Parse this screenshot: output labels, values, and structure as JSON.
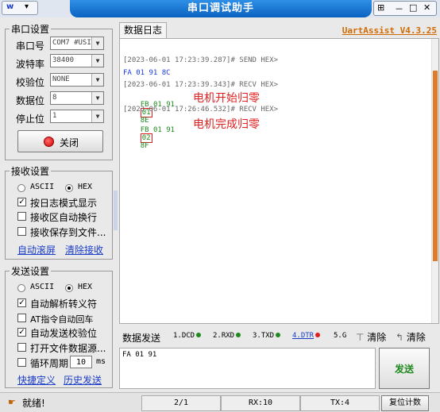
{
  "window": {
    "title": "串口调试助手",
    "menu_icon": "w",
    "menu_arrow": "▾",
    "pin": "⊞",
    "minimize": "－",
    "maximize": "□",
    "close": "✕"
  },
  "serial": {
    "group_title": "串口设置",
    "port_label": "串口号",
    "port_value": "COM7 #USI",
    "baud_label": "波特率",
    "baud_value": "38400",
    "parity_label": "校验位",
    "parity_value": "NONE",
    "databits_label": "数据位",
    "databits_value": "8",
    "stopbits_label": "停止位",
    "stopbits_value": "1",
    "close_label": "关闭"
  },
  "receive": {
    "group_title": "接收设置",
    "ascii": "ASCII",
    "hex": "HEX",
    "log_mode": "按日志模式显示",
    "auto_wrap": "接收区自动换行",
    "save_file": "接收保存到文件...",
    "auto_scroll": "自动滚屏",
    "clear": "清除接收"
  },
  "send": {
    "group_title": "发送设置",
    "ascii": "ASCII",
    "hex": "HEX",
    "auto_parse": "自动解析转义符",
    "at_enter": "AT指令自动回车",
    "auto_check": "自动发送校验位",
    "open_file": "打开文件数据源...",
    "cycle_label": "循环周期",
    "cycle_value": "10",
    "cycle_unit": "ms",
    "shortcuts": "快捷定义",
    "history": "历史发送"
  },
  "log": {
    "tab": "数据日志",
    "brand": "UartAssist V4.3.25",
    "lines": [
      "[2023-06-01 17:23:39.287]# SEND HEX>",
      "FA 01 91 8C",
      "[2023-06-01 17:23:39.343]# RECV HEX>",
      "[2023-06-01 17:26:46.532]# RECV HEX>"
    ],
    "recv1_pre": "FB 01 91",
    "recv1_box": "01",
    "recv1_post": "8E",
    "recv1_note": "电机开始归零",
    "recv2_pre": "FB 01 91",
    "recv2_box": "02",
    "recv2_post": "8F",
    "recv2_note": "电机完成归零"
  },
  "sendbar": {
    "tab": "数据发送",
    "dcd": "1.DCD",
    "rxd": "2.RXD",
    "txd": "3.TXD",
    "dtr": "4.DTR",
    "g5": "5.G",
    "clear1": "清除",
    "clear2": "清除",
    "input": "FA 01 91",
    "send_btn": "发送"
  },
  "status": {
    "ready": "就绪!",
    "page": "2/1",
    "rx": "RX:10",
    "tx": "TX:4",
    "reset": "复位计数"
  },
  "colors": {
    "green_dot": "#1f8a1f",
    "red_dot": "#e02020"
  }
}
